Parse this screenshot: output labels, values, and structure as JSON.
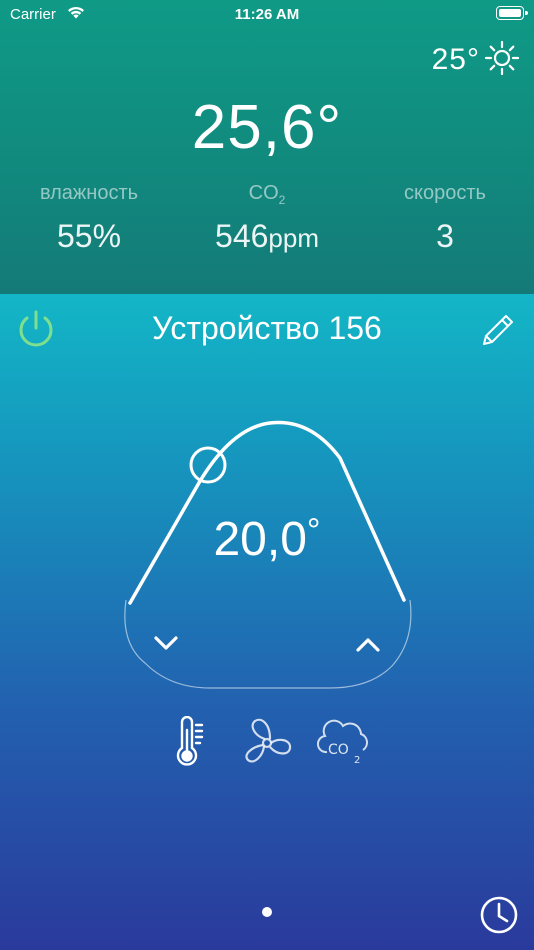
{
  "status_bar": {
    "carrier": "Carrier",
    "time": "11:26 AM"
  },
  "outside": {
    "temperature": "25°",
    "icon": "sun-icon"
  },
  "indoor": {
    "temperature": "25,6°"
  },
  "stats": [
    {
      "label": "влажность",
      "value": "55%"
    },
    {
      "label": "CO",
      "label_sub": "2",
      "value": "546",
      "value_unit": "ppm"
    },
    {
      "label": "скорость",
      "value": "3"
    }
  ],
  "device": {
    "name": "Устройство 156"
  },
  "control": {
    "set_int": "20,",
    "set_dec": "0",
    "degree": "°"
  },
  "modes": [
    {
      "icon": "thermometer-icon",
      "active": true
    },
    {
      "icon": "fan-icon",
      "active": false
    },
    {
      "icon": "co2-cloud-icon",
      "active": false,
      "text": "CO",
      "text_sub": "2"
    }
  ],
  "colors": {
    "top_bg": "#118a7e",
    "bottom_bg_top": "#13b6c6",
    "bottom_bg_bottom": "#2a3a9c",
    "power_accent": "#7ee08e"
  },
  "pager": {
    "current_page": 1,
    "total_pages": 1
  }
}
